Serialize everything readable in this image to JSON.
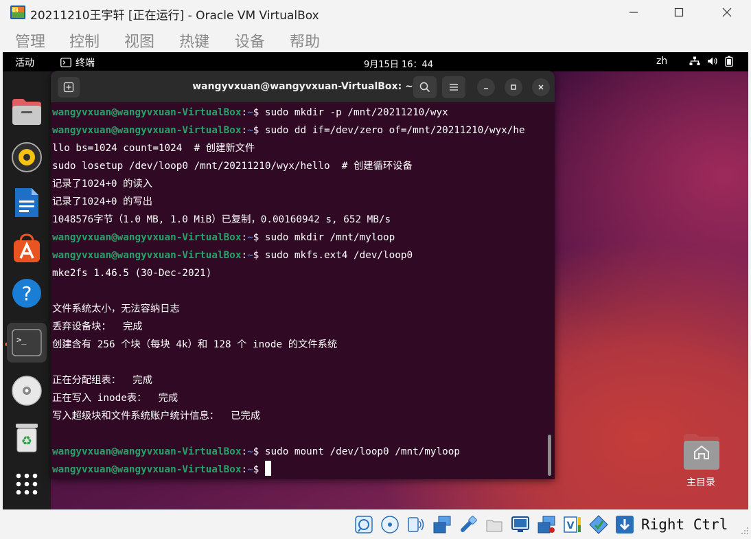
{
  "window": {
    "title": "20211210王宇轩 [正在运行] - Oracle VM VirtualBox",
    "app_icon": "virtualbox-icon"
  },
  "menubar": [
    "管理",
    "控制",
    "视图",
    "热键",
    "设备",
    "帮助"
  ],
  "guest_topbar": {
    "activities": "活动",
    "app_name": "终端",
    "clock": "9月15日 16：44",
    "input_lang": "zh"
  },
  "dock": {
    "items": [
      "files-icon",
      "rhythmbox-icon",
      "writer-icon",
      "app-center-icon",
      "help-icon",
      "terminal-icon",
      "dvd-icon",
      "trash-icon",
      "show-apps-icon"
    ]
  },
  "terminal": {
    "title": "wangyvxuan@wangyvxuan-VirtualBox: ~",
    "prompt_user": "wangyvxuan@wangyvxuan-VirtualBox",
    "prompt_path": "~",
    "lines": [
      {
        "type": "prompt",
        "text": "$ sudo mkdir -p /mnt/20211210/wyx"
      },
      {
        "type": "prompt",
        "text": "$ sudo dd if=/dev/zero of=/mnt/20211210/wyx/he"
      },
      {
        "type": "output",
        "text": "llo bs=1024 count=1024  # 创建新文件"
      },
      {
        "type": "output",
        "text": "sudo losetup /dev/loop0 /mnt/20211210/wyx/hello  # 创建循环设备"
      },
      {
        "type": "output",
        "text": "记录了1024+0 的读入"
      },
      {
        "type": "output",
        "text": "记录了1024+0 的写出"
      },
      {
        "type": "output",
        "text": "1048576字节（1.0 MB, 1.0 MiB）已复制，0.00160942 s, 652 MB/s"
      },
      {
        "type": "prompt",
        "text": "$ sudo mkdir /mnt/myloop"
      },
      {
        "type": "prompt",
        "text": "$ sudo mkfs.ext4 /dev/loop0"
      },
      {
        "type": "output",
        "text": "mke2fs 1.46.5 (30-Dec-2021)"
      },
      {
        "type": "output",
        "text": ""
      },
      {
        "type": "output",
        "text": "文件系统太小，无法容纳日志"
      },
      {
        "type": "output",
        "text": "丢弃设备块：  完成"
      },
      {
        "type": "output",
        "text": "创建含有 256 个块（每块 4k）和 128 个 inode 的文件系统"
      },
      {
        "type": "output",
        "text": ""
      },
      {
        "type": "output",
        "text": "正在分配组表：  完成"
      },
      {
        "type": "output",
        "text": "正在写入 inode表：  完成"
      },
      {
        "type": "output",
        "text": "写入超级块和文件系统账户统计信息：  已完成"
      },
      {
        "type": "output",
        "text": ""
      },
      {
        "type": "prompt",
        "text": "$ sudo mount /dev/loop0 /mnt/myloop"
      },
      {
        "type": "prompt-cursor",
        "text": "$ "
      }
    ]
  },
  "desktop": {
    "home_label": "主目录"
  },
  "statusbar": {
    "host_key": "Right Ctrl"
  },
  "colors": {
    "terminal_bg": "#300a24",
    "prompt_user": "#26a269",
    "prompt_path": "#3d7ad3",
    "ubuntu_orange": "#e95420"
  }
}
